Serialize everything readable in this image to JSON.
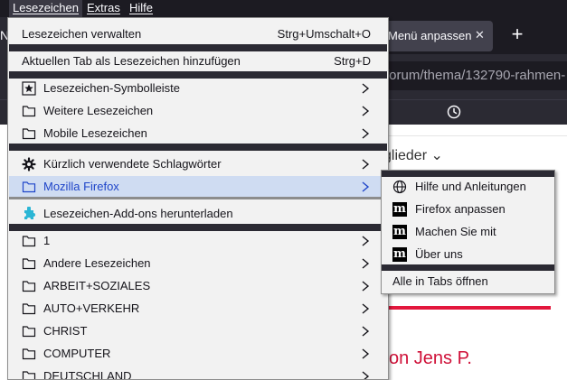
{
  "menubar": {
    "items": [
      {
        "label": "Lesezeichen",
        "active": true
      },
      {
        "label": "Extras",
        "active": false
      },
      {
        "label": "Hilfe",
        "active": false
      }
    ]
  },
  "tabs": {
    "left_fragment": "N",
    "active_title": "Menü anpassen",
    "close_glyph": "✕",
    "new_tab_glyph": "+"
  },
  "urlbar": {
    "value": "forum/thema/132790-rahmen-"
  },
  "page": {
    "members_text": "glieder ⌄",
    "author_text": "on Jens P."
  },
  "bookmarks_menu": {
    "manage": {
      "label": "Lesezeichen verwalten",
      "shortcut": "Strg+Umschalt+O"
    },
    "add_current": {
      "label": "Aktuellen Tab als Lesezeichen hinzufügen",
      "shortcut": "Strg+D"
    },
    "toolbar_folders": [
      {
        "label": "Lesezeichen-Symbolleiste",
        "icon": "star-box-icon"
      },
      {
        "label": "Weitere Lesezeichen",
        "icon": "folder-icon"
      },
      {
        "label": "Mobile Lesezeichen",
        "icon": "folder-icon"
      }
    ],
    "recent_tags": {
      "label": "Kürzlich verwendete Schlagwörter",
      "icon": "gear-icon"
    },
    "mozilla_firefox": {
      "label": "Mozilla Firefox",
      "icon": "folder-icon"
    },
    "addons": {
      "label": "Lesezeichen-Add-ons herunterladen",
      "icon": "puzzle-icon"
    },
    "folders": [
      {
        "label": "1"
      },
      {
        "label": "Andere Lesezeichen"
      },
      {
        "label": "ARBEIT+SOZIALES"
      },
      {
        "label": "AUTO+VERKEHR"
      },
      {
        "label": "CHRIST"
      },
      {
        "label": "COMPUTER"
      },
      {
        "label": "DEUTSCHLAND"
      }
    ]
  },
  "firefox_submenu": {
    "items": [
      {
        "label": "Hilfe und Anleitungen",
        "icon": "globe-icon"
      },
      {
        "label": "Firefox anpassen",
        "icon": "mozilla-logo-icon"
      },
      {
        "label": "Machen Sie mit",
        "icon": "mozilla-logo-icon"
      },
      {
        "label": "Über uns",
        "icon": "mozilla-logo-icon"
      }
    ],
    "open_all": "Alle in Tabs öffnen"
  },
  "colors": {
    "menu_bg": "#f2f2f2",
    "hover_bg": "#cfdcf2",
    "hover_text": "#1f45c9",
    "chrome_dark": "#1c1b22",
    "accent_red": "#e3173d"
  }
}
